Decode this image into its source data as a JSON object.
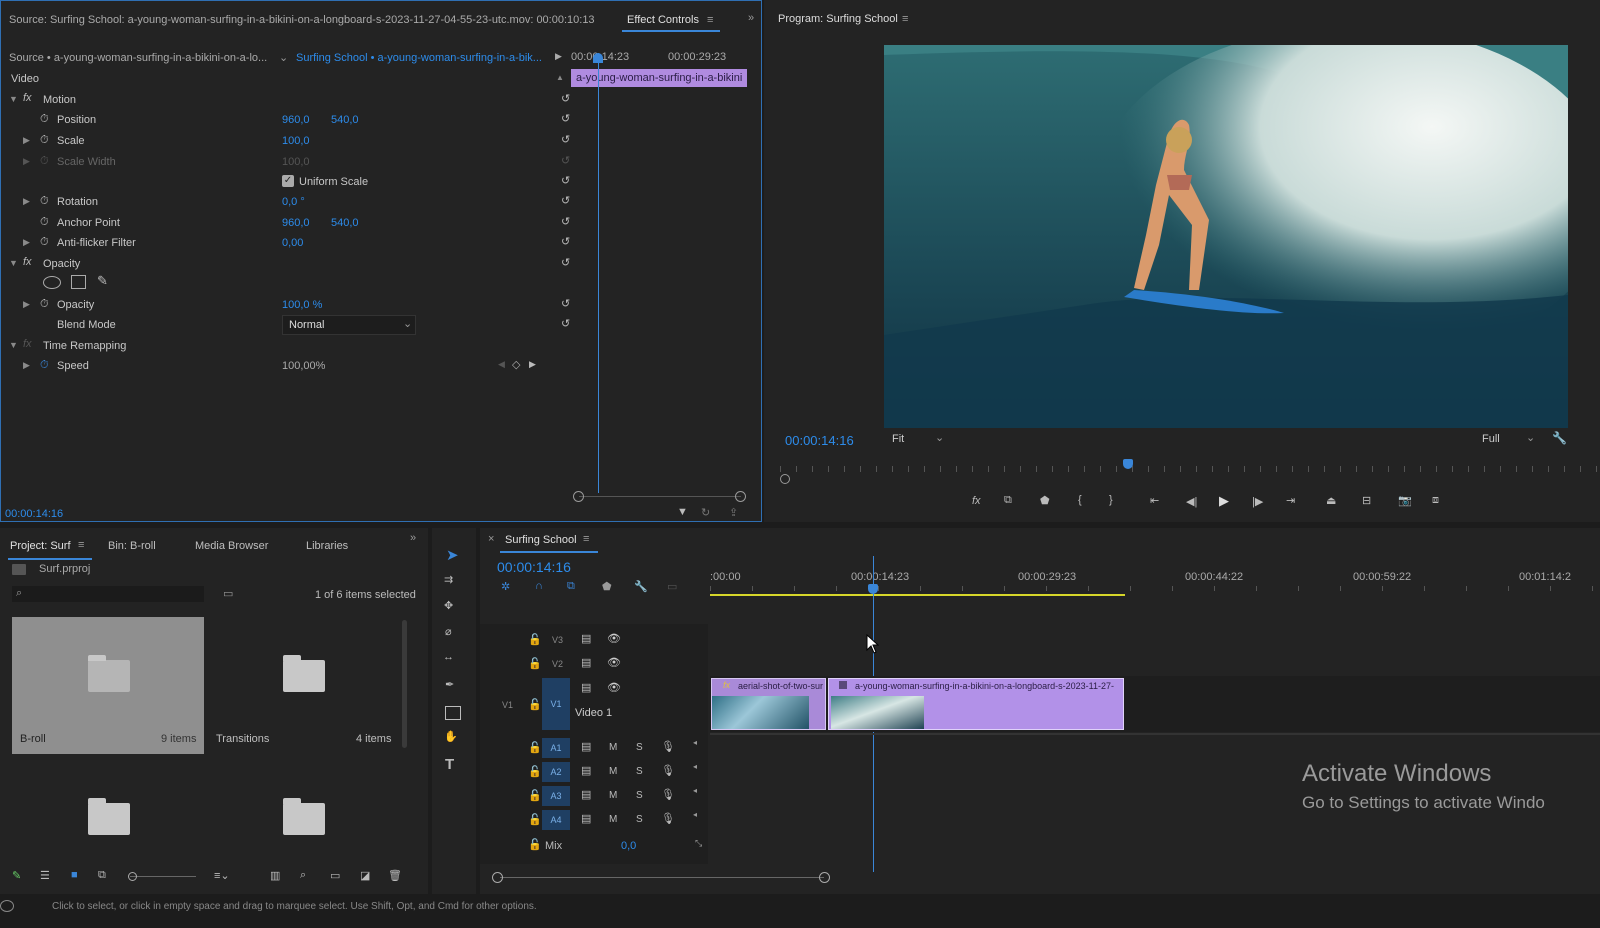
{
  "effect_controls": {
    "source_tab": "Source: Surfing School: a-young-woman-surfing-in-a-bikini-on-a-longboard-s-2023-11-27-04-55-23-utc.mov: 00:00:10:13",
    "tab_label": "Effect Controls",
    "source_selector": "Source • a-young-woman-surfing-in-a-bikini-on-a-lo...",
    "sequence_selector": "Surfing School • a-young-woman-surfing-in-a-bik...",
    "ruler_times": [
      "00:00:14:23",
      "00:00:29:23"
    ],
    "clip_label": "a-young-woman-surfing-in-a-bikini",
    "section_video": "Video",
    "motion": "Motion",
    "position_label": "Position",
    "position_x": "960,0",
    "position_y": "540,0",
    "scale_label": "Scale",
    "scale_value": "100,0",
    "scale_width_label": "Scale Width",
    "scale_width_value": "100,0",
    "uniform_scale": "Uniform Scale",
    "rotation_label": "Rotation",
    "rotation_value": "0,0 °",
    "anchor_label": "Anchor Point",
    "anchor_x": "960,0",
    "anchor_y": "540,0",
    "antiflicker_label": "Anti-flicker Filter",
    "antiflicker_value": "0,00",
    "opacity_section": "Opacity",
    "opacity_label": "Opacity",
    "opacity_value": "100,0 %",
    "blend_label": "Blend Mode",
    "blend_value": "Normal",
    "time_remap": "Time Remapping",
    "speed_label": "Speed",
    "speed_value": "100,00%",
    "timecode": "00:00:14:16"
  },
  "program": {
    "title": "Program: Surfing School",
    "timecode": "00:00:14:16",
    "fit": "Fit",
    "quality": "Full"
  },
  "project": {
    "tabs": [
      "Project: Surf",
      "Bin: B-roll",
      "Media Browser",
      "Libraries"
    ],
    "file": "Surf.prproj",
    "selection": "1 of 6 items selected",
    "bins": [
      {
        "name": "B-roll",
        "count": "9 items"
      },
      {
        "name": "Transitions",
        "count": "4 items"
      }
    ]
  },
  "timeline": {
    "title": "Surfing School",
    "timecode": "00:00:14:16",
    "ruler": [
      ":00:00",
      "00:00:14:23",
      "00:00:29:23",
      "00:00:44:22",
      "00:00:59:22",
      "00:01:14:2"
    ],
    "video_tracks": [
      "V3",
      "V2",
      "V1"
    ],
    "source_patch_v": "V1",
    "video1_name": "Video 1",
    "audio_tracks": [
      "A1",
      "A2",
      "A3",
      "A4"
    ],
    "mute": "M",
    "solo": "S",
    "mix_label": "Mix",
    "mix_value": "0,0",
    "clip1": "aerial-shot-of-two-sur",
    "clip2": "a-young-woman-surfing-in-a-bikini-on-a-longboard-s-2023-11-27-"
  },
  "watermark": {
    "line1": "Activate Windows",
    "line2": "Go to Settings to activate Windo"
  },
  "status_bar": "Click to select, or click in empty space and drag to marquee select. Use Shift, Opt, and Cmd for other options."
}
